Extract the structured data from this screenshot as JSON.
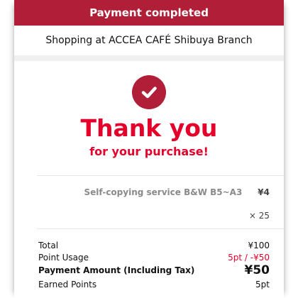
{
  "header": {
    "title": "Payment completed"
  },
  "store": {
    "label": "Shopping at ACCEA CAFÉ Shibuya Branch"
  },
  "hero": {
    "thanks": "Thank you",
    "subtitle": "for your purchase!"
  },
  "item": {
    "name": "Self-copying service B&W B5~A3",
    "price": "¥4",
    "quantity": "× 25"
  },
  "totals": {
    "total_label": "Total",
    "total_value": "¥100",
    "point_usage_label": "Point Usage",
    "point_usage_value": "5pt / -¥50",
    "payment_label": "Payment Amount (Including Tax)",
    "payment_value": "¥50",
    "earned_label": "Earned Points",
    "earned_value": "5pt"
  },
  "colors": {
    "brand": "#b01e38",
    "accent_red": "#e4002b"
  },
  "icons": {
    "status": "check-circle-icon"
  }
}
